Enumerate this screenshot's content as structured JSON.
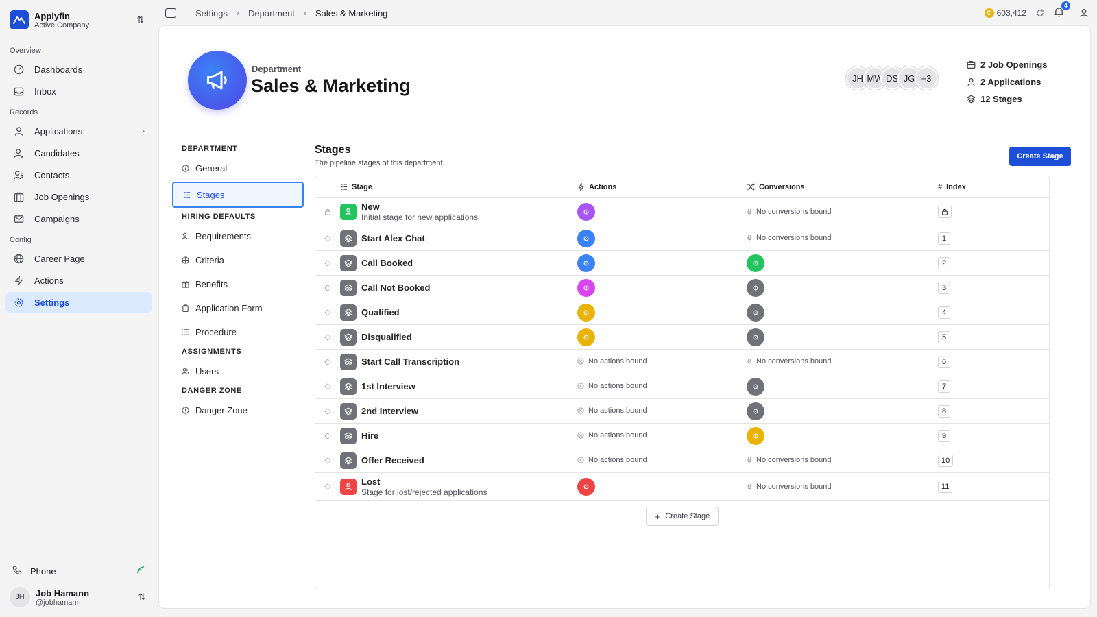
{
  "brand": {
    "name": "Applyfin",
    "subtitle": "Active Company",
    "color": "#1d4ed8"
  },
  "sidebar": {
    "sections": {
      "overview": "Overview",
      "records": "Records",
      "config": "Config"
    },
    "items": {
      "dashboards": "Dashboards",
      "inbox": "Inbox",
      "applications": "Applications",
      "candidates": "Candidates",
      "contacts": "Contacts",
      "job_openings": "Job Openings",
      "campaigns": "Campaigns",
      "career_page": "Career Page",
      "actions": "Actions",
      "settings": "Settings"
    },
    "phone": "Phone",
    "user": {
      "initials": "JH",
      "name": "Job Hamann",
      "handle": "@jobhamann"
    }
  },
  "topbar": {
    "breadcrumbs": [
      "Settings",
      "Department",
      "Sales & Marketing"
    ],
    "coin_symbol": "C",
    "credits": "603,412",
    "notifications": "4"
  },
  "department": {
    "kicker": "Department",
    "title": "Sales & Marketing",
    "members": [
      "JH",
      "MW",
      "DS",
      "JG",
      "+3"
    ],
    "stats": {
      "job_openings": "2 Job Openings",
      "applications": "2 Applications",
      "stages": "12 Stages"
    }
  },
  "settings_nav": {
    "department_label": "DEPARTMENT",
    "general": "General",
    "stages": "Stages",
    "hiring_label": "HIRING DEFAULTS",
    "requirements": "Requirements",
    "criteria": "Criteria",
    "benefits": "Benefits",
    "application_form": "Application Form",
    "procedure": "Procedure",
    "assignments_label": "ASSIGNMENTS",
    "users": "Users",
    "danger_label": "DANGER ZONE",
    "danger_zone": "Danger Zone"
  },
  "stages": {
    "title": "Stages",
    "description": "The pipeline stages of this department.",
    "create_button": "Create Stage",
    "add_button": "Create Stage",
    "columns": {
      "stage": "Stage",
      "actions": "Actions",
      "conversions": "Conversions",
      "index": "Index"
    },
    "no_actions": "No actions bound",
    "no_conversions": "No conversions bound",
    "rows": [
      {
        "name": "New",
        "sub": "Initial stage for new applications",
        "action_color": "#a855f7",
        "conversion": "",
        "index": "",
        "locked": true,
        "icon_style": "green"
      },
      {
        "name": "Start Alex Chat",
        "action_color": "#3b82f6",
        "conversion": "",
        "index": "1"
      },
      {
        "name": "Call Booked",
        "action_color": "#3b82f6",
        "conversion": "#22c55e",
        "index": "2"
      },
      {
        "name": "Call Not Booked",
        "action_color": "#d946ef",
        "conversion": "#71717a",
        "index": "3"
      },
      {
        "name": "Qualified",
        "action_color": "#eab308",
        "conversion": "#71717a",
        "index": "4"
      },
      {
        "name": "Disqualified",
        "action_color": "#eab308",
        "conversion": "#71717a",
        "index": "5"
      },
      {
        "name": "Start Call Transcription",
        "action_color": "",
        "conversion": "",
        "index": "6"
      },
      {
        "name": "1st Interview",
        "action_color": "",
        "conversion": "#71717a",
        "index": "7"
      },
      {
        "name": "2nd Interview",
        "action_color": "",
        "conversion": "#71717a",
        "index": "8"
      },
      {
        "name": "Hire",
        "action_color": "",
        "conversion": "#eab308",
        "index": "9"
      },
      {
        "name": "Offer Received",
        "action_color": "",
        "conversion": "",
        "index": "10"
      },
      {
        "name": "Lost",
        "sub": "Stage for lost/rejected applications",
        "action_color": "#ef4444",
        "conversion": "",
        "index": "11",
        "icon_style": "red"
      }
    ]
  }
}
